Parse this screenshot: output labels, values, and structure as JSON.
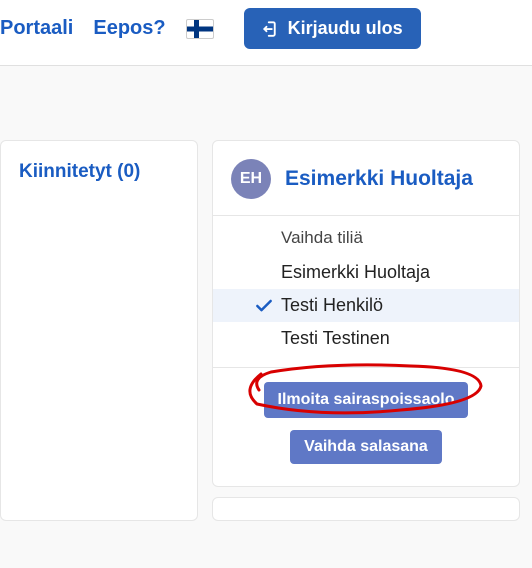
{
  "header": {
    "nav_portal": "Portaali",
    "nav_eepos": "Eepos?",
    "logout_label": "Kirjaudu ulos"
  },
  "pinned": {
    "title": "Kiinnitetyt (0)"
  },
  "profile": {
    "avatar_initials": "EH",
    "name": "Esimerkki Huoltaja",
    "switch_label": "Vaihda tiliä"
  },
  "accounts": [
    {
      "name": "Esimerkki Huoltaja",
      "selected": false
    },
    {
      "name": "Testi Henkilö",
      "selected": true
    },
    {
      "name": "Testi Testinen",
      "selected": false
    }
  ],
  "actions": {
    "report_sick": "Ilmoita sairaspoissaolo",
    "change_password": "Vaihda salasana"
  },
  "colors": {
    "link": "#1a5cc2",
    "button_primary": "#2862b7",
    "button_secondary": "#5f78c6",
    "avatar_bg": "#7b83b8",
    "annotation": "#d80000"
  }
}
